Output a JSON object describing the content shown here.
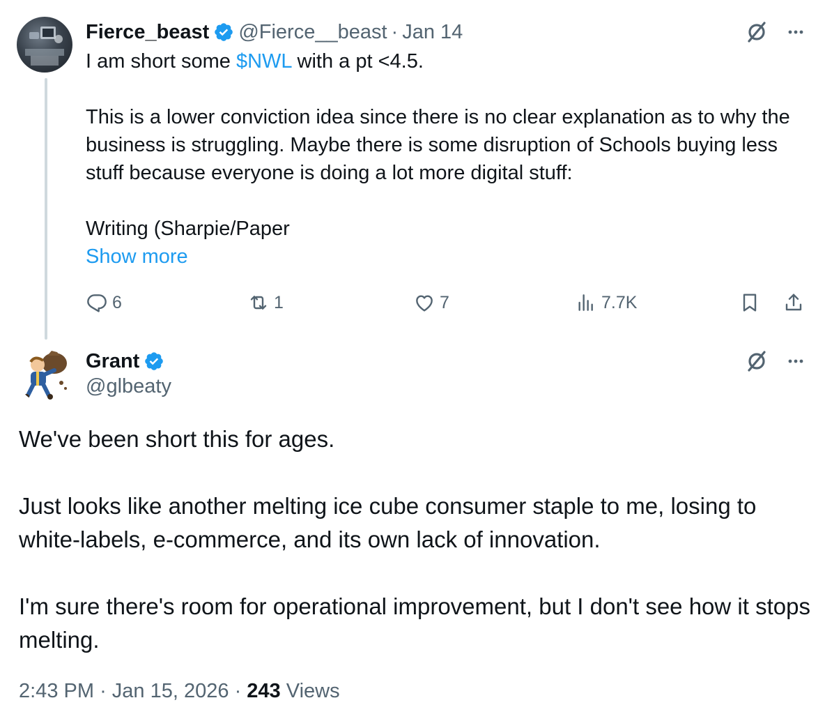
{
  "tweet1": {
    "author_name": "Fierce_beast",
    "handle": "@Fierce__beast",
    "separator": "·",
    "date": "Jan 14",
    "text_before_cashtag": "I am short some ",
    "cashtag": "$NWL",
    "text_after_cashtag": " with a pt <4.5.",
    "paragraph_2": "This is a lower conviction idea since there is no clear explanation as to why the business is struggling. Maybe there is some disruption of Schools buying less stuff because everyone is doing a lot more digital stuff:",
    "paragraph_3": "Writing (Sharpie/Paper",
    "show_more_label": "Show more",
    "replies": "6",
    "reposts": "1",
    "likes": "7",
    "views": "7.7K"
  },
  "tweet2": {
    "author_name": "Grant",
    "handle": "@glbeaty",
    "paragraph_1": "We've been short this for ages.",
    "paragraph_2": "Just looks like another melting ice cube consumer staple to me, losing to white-labels, e-commerce, and its own lack of innovation.",
    "paragraph_3": "I'm sure there's room for operational improvement, but I don't see how it stops melting.",
    "time": "2:43 PM",
    "separator": "·",
    "date": "Jan 15, 2026",
    "views_count": "243",
    "views_label": "Views"
  },
  "icons": {
    "verified": "verified-badge-icon",
    "grok": "grok-icon",
    "more": "more-icon",
    "reply": "reply-icon",
    "repost": "repost-icon",
    "like": "like-icon",
    "views": "views-icon",
    "bookmark": "bookmark-icon",
    "share": "share-icon"
  },
  "colors": {
    "accent": "#1d9bf0",
    "text": "#0f1419",
    "muted": "#536471",
    "thread_line": "#cfd9de"
  }
}
